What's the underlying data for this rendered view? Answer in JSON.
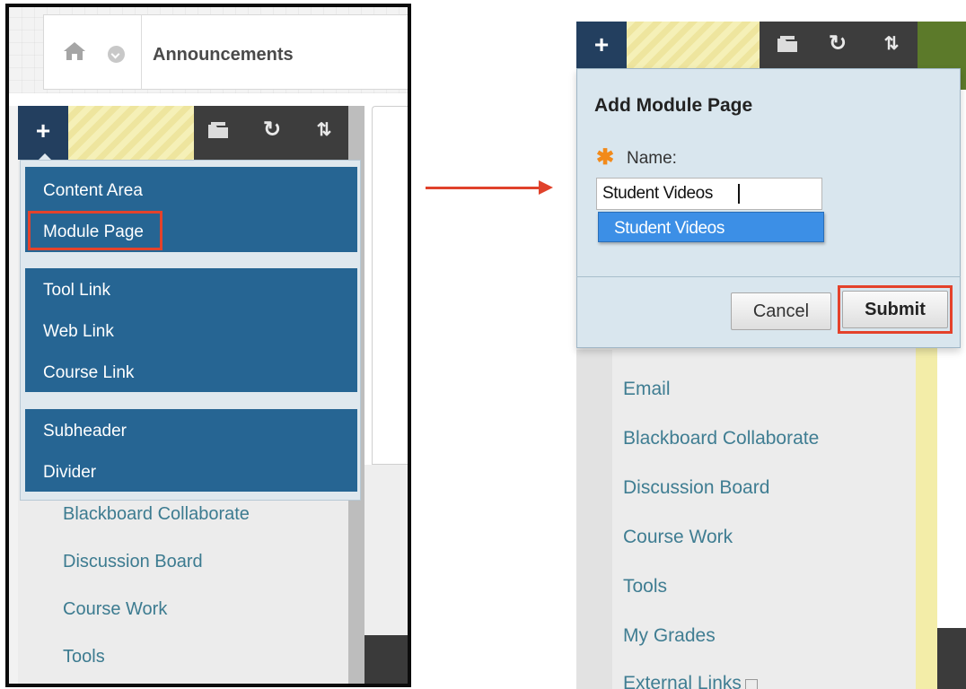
{
  "left_panel": {
    "breadcrumb": {
      "title": "Announcements"
    },
    "dropdown": {
      "group1": [
        "Content Area",
        "Module Page"
      ],
      "group2": [
        "Tool Link",
        "Web Link",
        "Course Link"
      ],
      "group3": [
        "Subheader",
        "Divider"
      ]
    },
    "menu_items": [
      "Blackboard Collaborate",
      "Discussion Board",
      "Course Work",
      "Tools"
    ]
  },
  "toolbar": {
    "plus": "+",
    "refresh": "↻",
    "sort": "⇅"
  },
  "right_panel": {
    "modal": {
      "title": "Add Module Page",
      "required_icon": "✱",
      "name_label": "Name:",
      "name_value": "Student Videos",
      "autocomplete_suggestion": "Student Videos",
      "cancel_label": "Cancel",
      "submit_label": "Submit"
    },
    "menu_items": [
      "Email",
      "Blackboard Collaborate",
      "Discussion Board",
      "Course Work",
      "Tools",
      "My Grades",
      "External Links"
    ]
  },
  "colors": {
    "highlight": "#e4422b",
    "menu_blue": "#266593",
    "link_teal": "#3c7b90",
    "required_orange": "#f28a1a"
  }
}
